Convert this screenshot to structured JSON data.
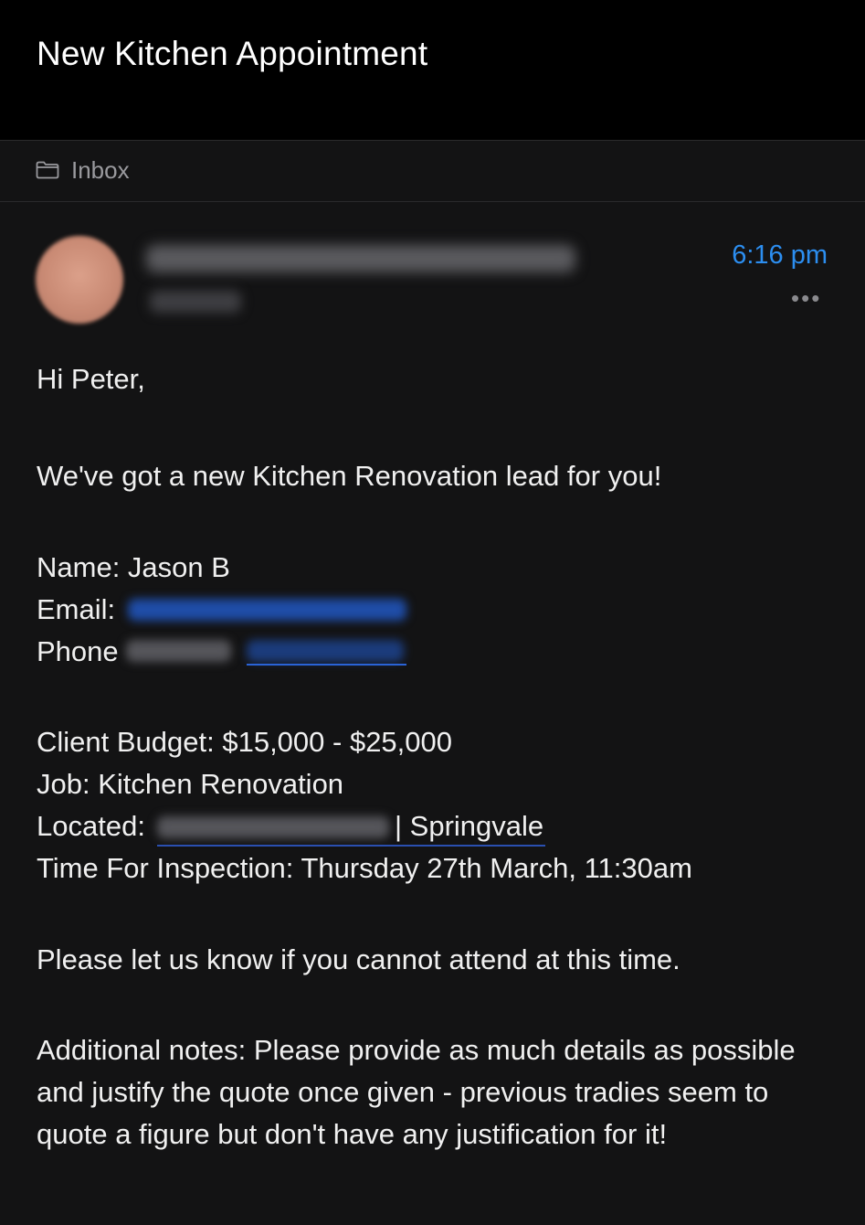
{
  "header": {
    "title": "New Kitchen Appointment"
  },
  "folder": {
    "icon": "folder-icon",
    "label": "Inbox"
  },
  "message": {
    "time": "6:16 pm",
    "more_label": "•••",
    "greeting": "Hi Peter,",
    "intro": "We've got a new Kitchen Renovation lead for you!",
    "name_line": "Name: Jason B",
    "email_label": "Email:",
    "phone_label": "Phone",
    "budget_line": "Client Budget: $15,000 - $25,000",
    "job_line": "Job: Kitchen Renovation",
    "located_label": "Located:",
    "located_suffix": "| Springvale",
    "inspection_line": "Time For Inspection: Thursday 27th March, 11:30am",
    "attend_line": "Please let us know if you cannot attend at this time.",
    "notes_line1": "Additional notes: Please provide as much details as possible",
    "notes_line2": "and justify the quote once given - previous tradies seem to",
    "notes_line3": "quote a figure but don't have any justification for it!"
  },
  "colors": {
    "background": "#131314",
    "header_background": "#000000",
    "accent_time": "#2c8ef0",
    "link_blue": "#2a63d6",
    "muted_text": "#9a9a9e"
  }
}
